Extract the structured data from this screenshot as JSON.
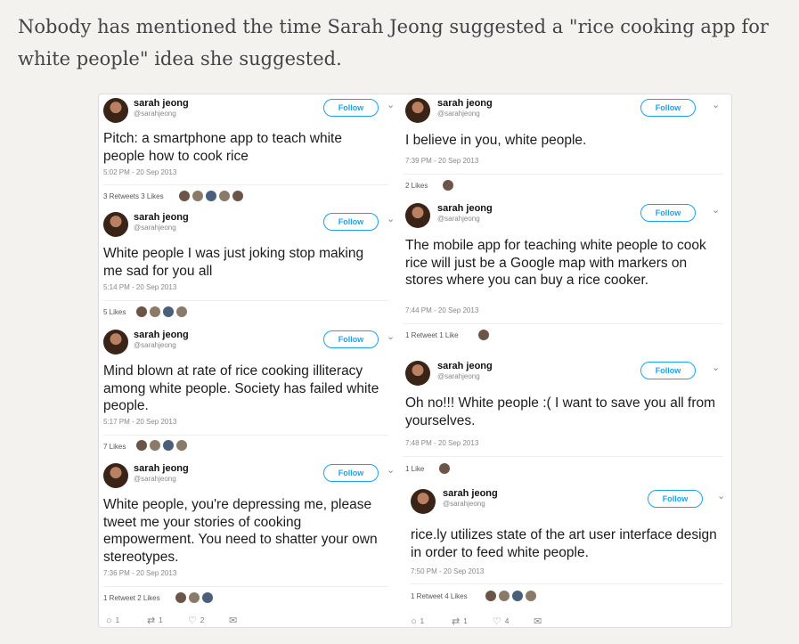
{
  "intro": "Nobody has mentioned the time Sarah Jeong suggested a \"rice cooking app for white people\" idea she suggested.",
  "follow_label": "Follow",
  "tweets": [
    {
      "name": "sarah jeong",
      "handle": "@sarahjeong",
      "text": "Pitch: a smartphone app to teach white people how to cook rice",
      "time": "5:02 PM - 20 Sep 2013",
      "stats": "3 Retweets   3 Likes"
    },
    {
      "name": "sarah jeong",
      "handle": "@sarahjeong",
      "text": "White people I was just joking stop making me sad for you all",
      "time": "5:14 PM - 20 Sep 2013",
      "stats": "5 Likes"
    },
    {
      "name": "sarah jeong",
      "handle": "@sarahjeong",
      "text": "Mind blown at rate of rice cooking illiteracy among white people. Society has failed white people.",
      "time": "5:17 PM - 20 Sep 2013",
      "stats": "7 Likes"
    },
    {
      "name": "sarah jeong",
      "handle": "@sarahjeong",
      "text": "White people, you're depressing me, please tweet me your stories of cooking empowerment. You need to shatter your own stereotypes.",
      "time": "7:36 PM - 20 Sep 2013",
      "stats": "1 Retweet   2 Likes"
    },
    {
      "name": "sarah jeong",
      "handle": "@sarahjeong",
      "text": "I believe in you, white people.",
      "time": "7:39 PM - 20 Sep 2013",
      "stats": "2 Likes"
    },
    {
      "name": "sarah jeong",
      "handle": "@sarahjeong",
      "text": "The mobile app for teaching white people to cook rice will just be a Google map with markers on stores where you can buy a rice cooker.",
      "time": "7:44 PM - 20 Sep 2013",
      "stats": "1 Retweet   1 Like"
    },
    {
      "name": "sarah jeong",
      "handle": "@sarahjeong",
      "text": "Oh no!!! White people :( I want to save you all from yourselves.",
      "time": "7:48 PM - 20 Sep 2013",
      "stats": "1 Like"
    },
    {
      "name": "sarah jeong",
      "handle": "@sarahjeong",
      "text": "rice.ly utilizes state of the art user interface design in order to feed white people.",
      "time": "7:50 PM - 20 Sep 2013",
      "stats": "1 Retweet   4 Likes"
    }
  ],
  "actions_left": {
    "reply": "1",
    "retweet": "1",
    "like": "2"
  },
  "actions_right": {
    "reply": "1",
    "retweet": "1",
    "like": "4"
  }
}
